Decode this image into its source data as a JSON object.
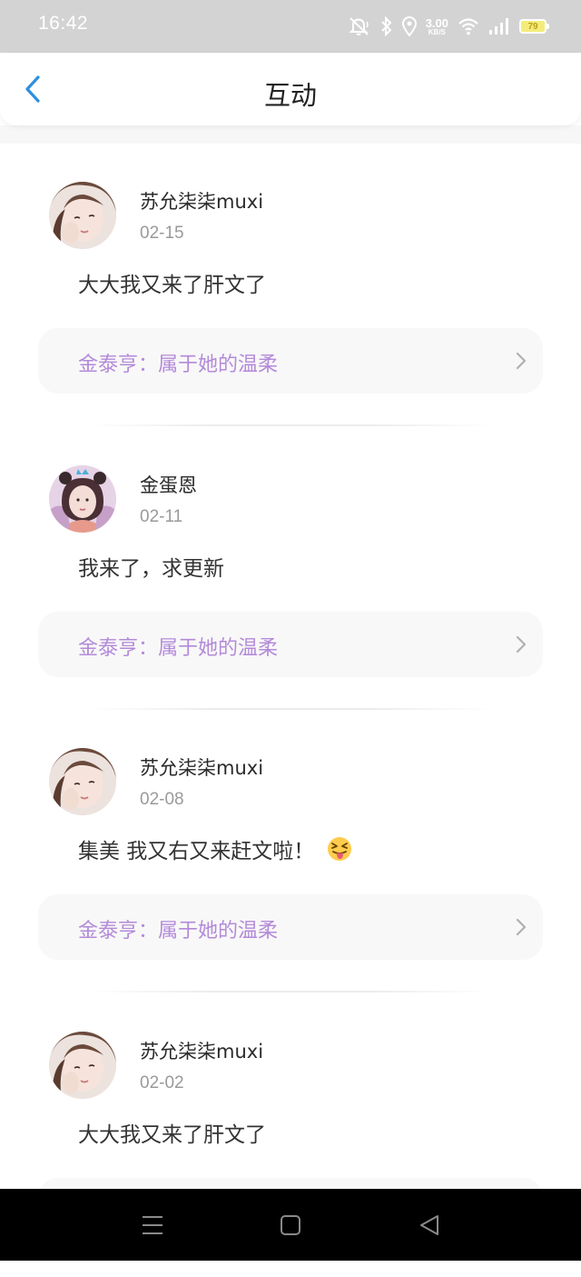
{
  "status_bar": {
    "time": "16:42",
    "net_speed_value": "3.00",
    "net_speed_unit": "KB/S",
    "battery_level": "79",
    "icons": [
      "mute-icon",
      "bluetooth-icon",
      "location-icon",
      "wifi-icon",
      "signal-icon",
      "battery-icon"
    ]
  },
  "header": {
    "title": "互动",
    "back_icon": "chevron-left-icon"
  },
  "colors": {
    "accent_blue": "#2d8fe0",
    "work_link_purple": "#b38ad9",
    "status_bar_bg": "#d3d3d3",
    "card_bg": "#f8f8f8"
  },
  "feed": [
    {
      "username": "苏允柒柒muxi",
      "date": "02-15",
      "comment": "大大我又来了肝文了",
      "emoji": "",
      "work_title": "金泰亨：属于她的温柔"
    },
    {
      "username": "金蛋恩",
      "date": "02-11",
      "comment": "我来了，求更新",
      "emoji": "",
      "work_title": "金泰亨：属于她的温柔"
    },
    {
      "username": "苏允柒柒muxi",
      "date": "02-08",
      "comment": "集美 我又右又来赶文啦！",
      "emoji": "squinting-tongue-emoji",
      "work_title": "金泰亨：属于她的温柔"
    },
    {
      "username": "苏允柒柒muxi",
      "date": "02-02",
      "comment": "大大我又来了肝文了",
      "emoji": "",
      "work_title": ""
    }
  ],
  "system_nav": {
    "icons": [
      "menu-icon",
      "home-icon",
      "back-triangle-icon"
    ]
  }
}
